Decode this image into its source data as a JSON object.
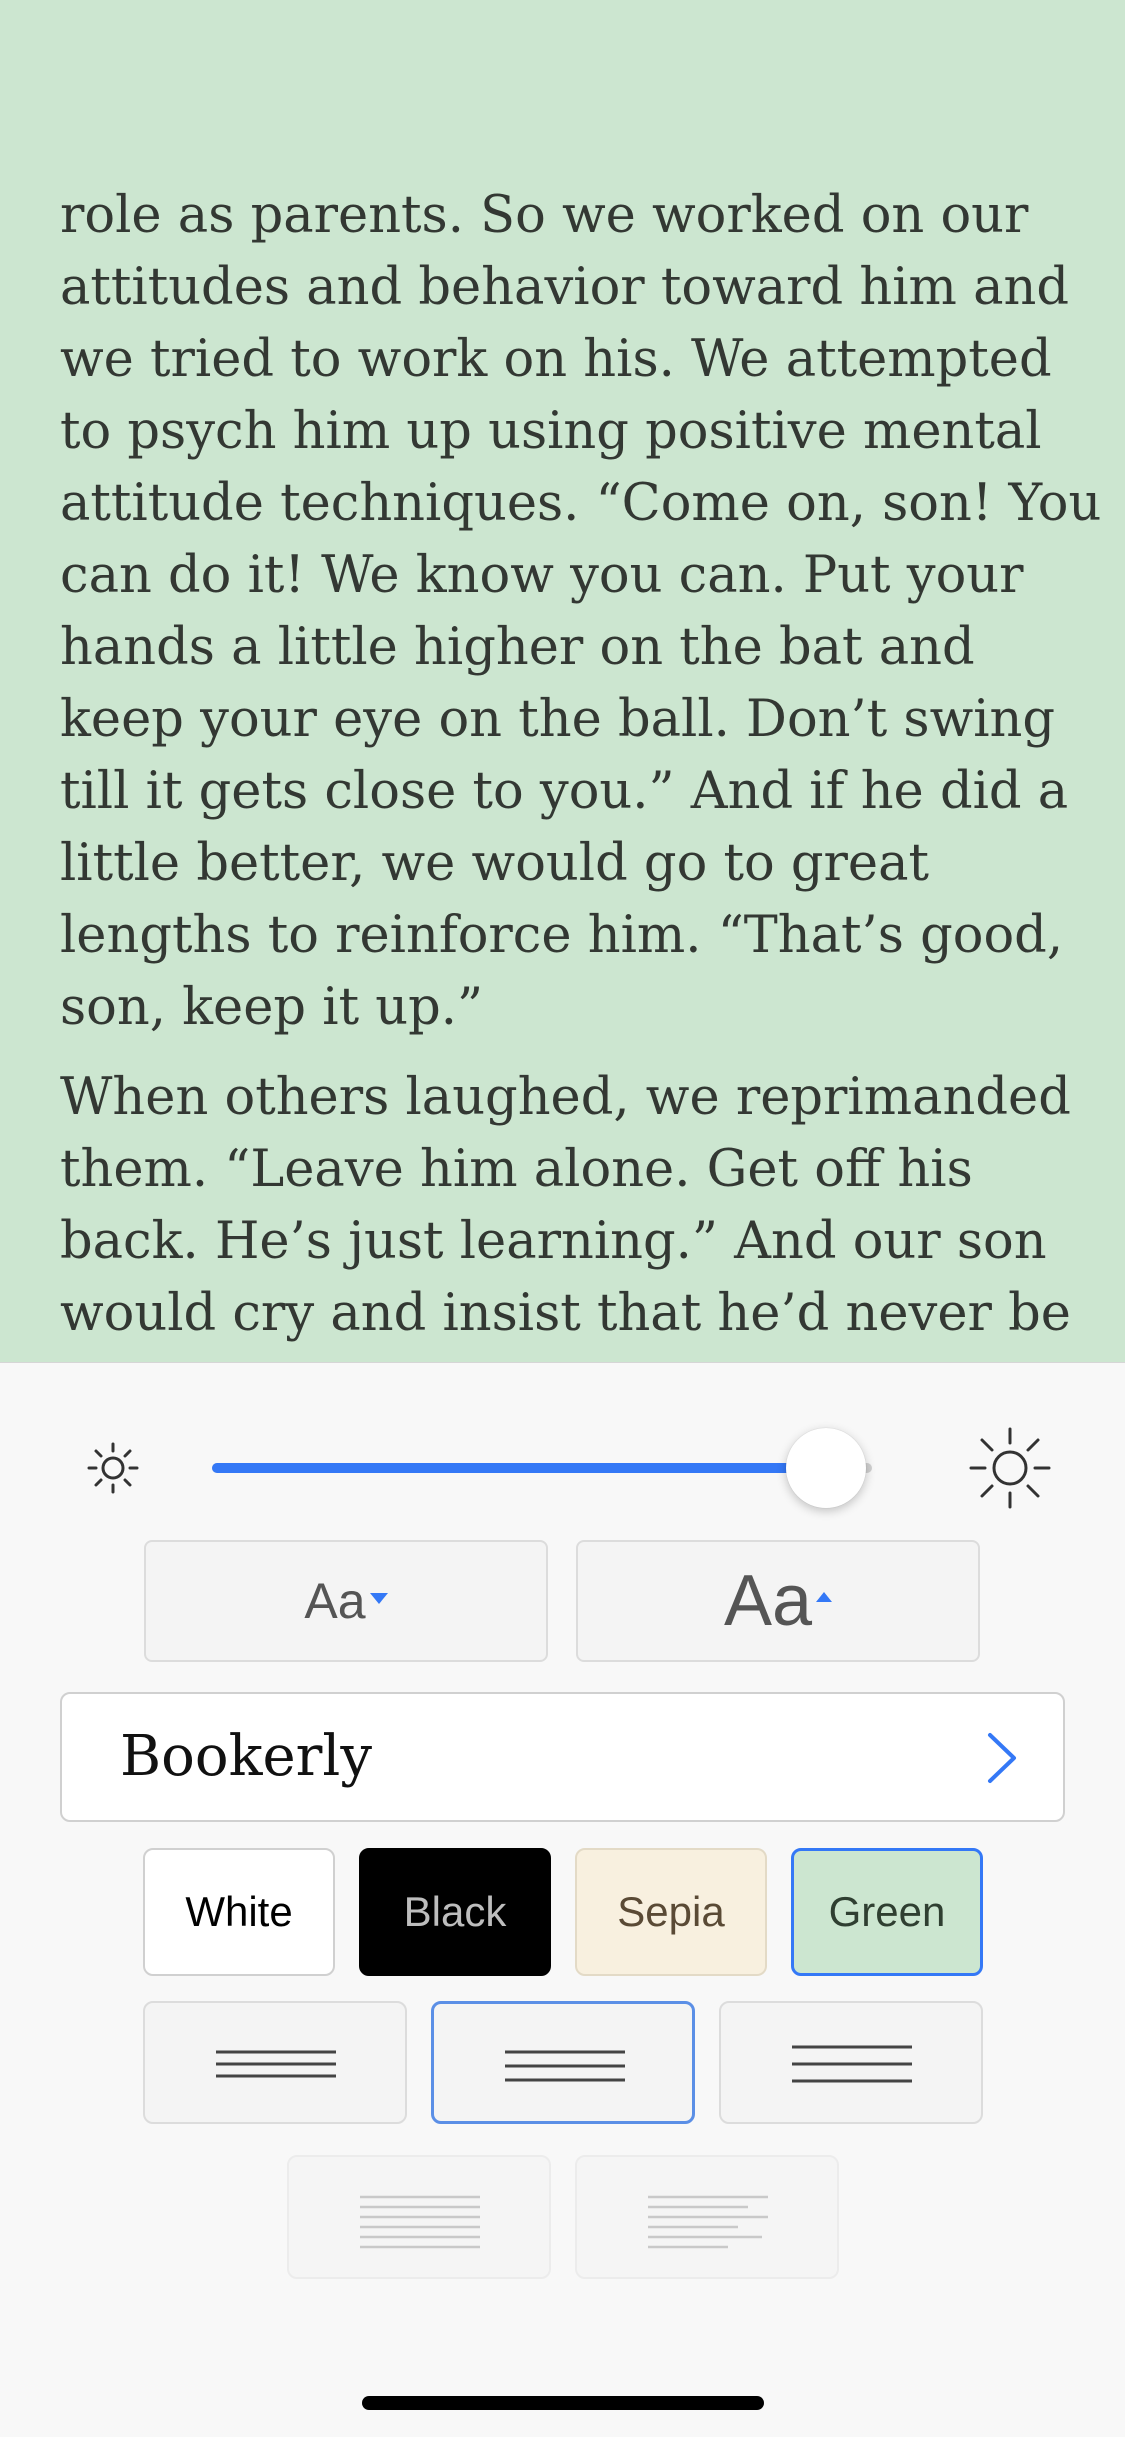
{
  "reader": {
    "paragraphs": [
      {
        "lines": [
          "role as parents. So we worked on our",
          "attitudes and behavior toward him and",
          "we tried to work on his. We attempted",
          "to psych him up using positive mental",
          "attitude techniques. “Come on, son! You",
          "can do it! We know you can. Put your",
          "hands a little higher on the bat and",
          "keep your eye on the ball. Don’t swing",
          "till it gets close to you.” And if he did a",
          "little better, we would go to great",
          "lengths to reinforce him. “That’s good,",
          "son, keep it up.”"
        ]
      },
      {
        "lines": [
          "When others laughed, we reprimanded",
          "them. “Leave him alone. Get off his",
          "back. He’s just learning.” And our son",
          "would cry and insist that he’d never be"
        ]
      }
    ],
    "background_color": "#cce6d0"
  },
  "settings": {
    "brightness": {
      "value": 0.93,
      "min_icon": "sun-small-icon",
      "max_icon": "sun-large-icon",
      "accent": "#3478f6"
    },
    "font_size": {
      "smaller_label": "Aa",
      "larger_label": "Aa"
    },
    "font_family": {
      "selected": "Bookerly",
      "icon": "chevron-right-icon"
    },
    "themes": [
      {
        "label": "White",
        "color": "#ffffff"
      },
      {
        "label": "Black",
        "color": "#000000"
      },
      {
        "label": "Sepia",
        "color": "#f8f0df"
      },
      {
        "label": "Green",
        "color": "#cce6d0",
        "selected": true
      }
    ],
    "margins": [
      {
        "name": "narrow-margins",
        "selected": false
      },
      {
        "name": "medium-margins",
        "selected": true
      },
      {
        "name": "wide-margins",
        "selected": false
      }
    ],
    "alignment": [
      {
        "name": "justify-align",
        "enabled": false
      },
      {
        "name": "left-align",
        "enabled": false
      }
    ]
  }
}
